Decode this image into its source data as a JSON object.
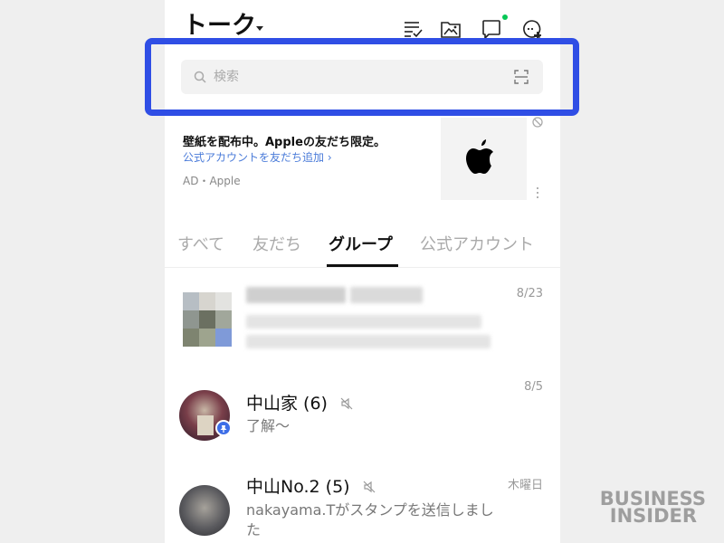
{
  "header": {
    "title": "トーク"
  },
  "search": {
    "placeholder": "検索"
  },
  "ad": {
    "title": "壁紙を配布中。Appleの友だち限定。",
    "link": "公式アカウントを友だち追加 ›",
    "meta": "AD・Apple"
  },
  "tabs": [
    {
      "label": "すべて",
      "active": false
    },
    {
      "label": "友だち",
      "active": false
    },
    {
      "label": "グループ",
      "active": true
    },
    {
      "label": "公式アカウント",
      "active": false
    }
  ],
  "chats": [
    {
      "name": "",
      "preview": "",
      "date": "8/23",
      "blurred": true
    },
    {
      "name": "中山家 (6)",
      "preview": "了解〜",
      "date": "8/5",
      "muted": true,
      "pinned": true
    },
    {
      "name": "中山No.2 (5)",
      "preview": "nakayama.Tがスタンプを送信しました",
      "date": "木曜日",
      "muted": true
    }
  ],
  "colors": {
    "highlight": "#2f4ee5",
    "link": "#4a7bd9",
    "online": "#06c755",
    "pin": "#3d6ee7"
  },
  "watermark": {
    "line1": "BUSINESS",
    "line2": "INSIDER"
  }
}
